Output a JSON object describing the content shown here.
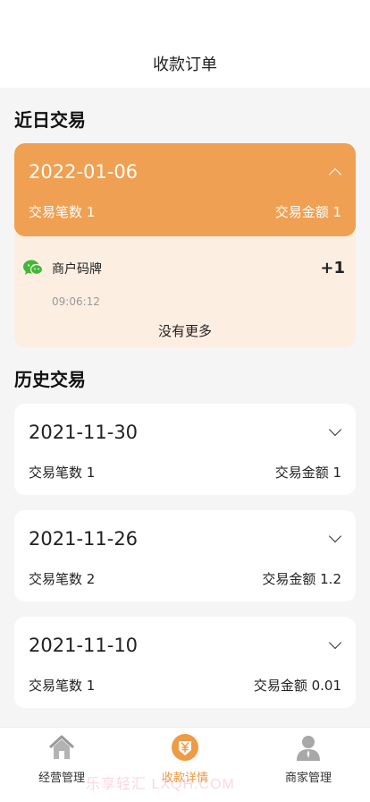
{
  "header": {
    "title": "收款订单"
  },
  "recent": {
    "section_title": "近日交易",
    "card": {
      "date": "2022-01-06",
      "count_text": "交易笔数 1",
      "amount_text": "交易金额 1",
      "expanded": true,
      "transactions": [
        {
          "icon": "wechat-icon",
          "name": "商户码牌",
          "amount": "+1",
          "time": "09:06:12"
        }
      ],
      "no_more": "没有更多"
    }
  },
  "history": {
    "section_title": "历史交易",
    "cards": [
      {
        "date": "2021-11-30",
        "count_text": "交易笔数 1",
        "amount_text": "交易金额 1"
      },
      {
        "date": "2021-11-26",
        "count_text": "交易笔数 2",
        "amount_text": "交易金额 1.2"
      },
      {
        "date": "2021-11-10",
        "count_text": "交易笔数 1",
        "amount_text": "交易金额 0.01"
      }
    ]
  },
  "tabbar": {
    "tabs": [
      {
        "label": "经营管理",
        "icon": "home-icon",
        "active": false
      },
      {
        "label": "收款详情",
        "icon": "yuan-download-icon",
        "active": true
      },
      {
        "label": "商家管理",
        "icon": "person-icon",
        "active": false
      }
    ]
  },
  "watermark": "乐享轻汇  LXQH.COM",
  "colors": {
    "accent": "#f0a052",
    "accent_light": "#fdeee2",
    "tab_active": "#ee9b45",
    "wechat_green": "#3fb835"
  }
}
